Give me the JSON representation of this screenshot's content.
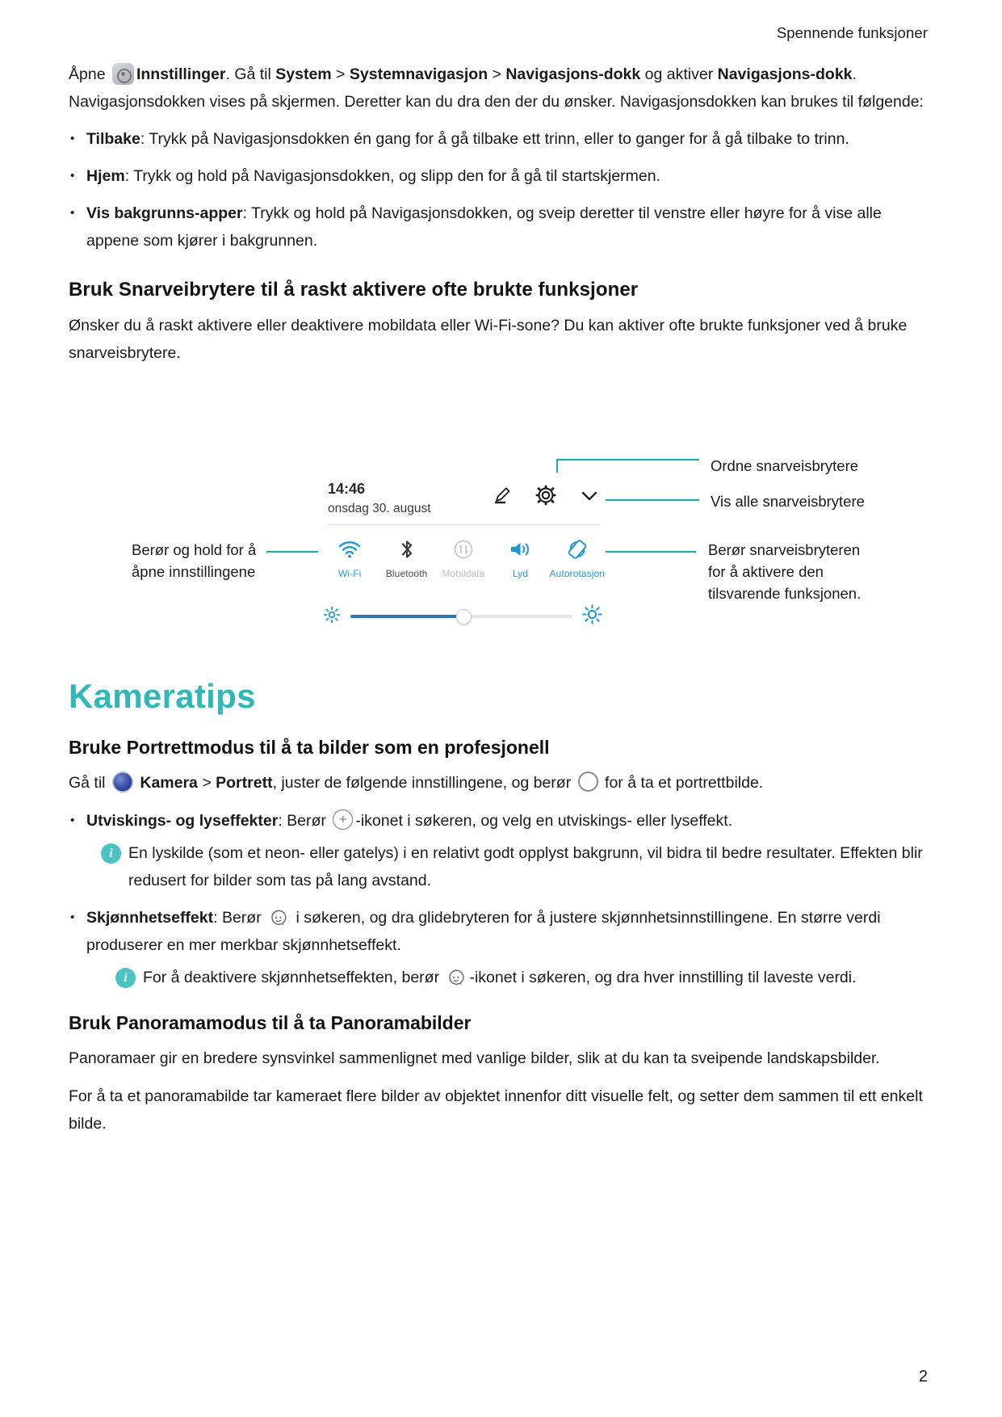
{
  "header": {
    "running_head": "Spennende funksjoner"
  },
  "page_number": "2",
  "intro": {
    "p1_a": "Åpne",
    "p1_icon": "settings-icon",
    "p1_b": "Innstillinger",
    "p1_c": ". Gå til ",
    "p1_d": "System",
    "p1_e": " > ",
    "p1_f": "Systemnavigasjon",
    "p1_g": " > ",
    "p1_h": "Navigasjons-dokk",
    "p1_i": " og aktiver ",
    "p1_j": "Navigasjons-dokk",
    "p1_k": ". Navigasjonsdokken vises på skjermen. Deretter kan du dra den der du ønsker. Navigasjonsdokken kan brukes til følgende:"
  },
  "nav_bullets": [
    {
      "term": "Tilbake",
      "text": ": Trykk på Navigasjonsdokken én gang for å gå tilbake ett trinn, eller to ganger for å gå tilbake to trinn."
    },
    {
      "term": "Hjem",
      "text": ": Trykk og hold på Navigasjonsdokken, og slipp den for å gå til startskjermen."
    },
    {
      "term": "Vis bakgrunns-apper",
      "text": ": Trykk og hold på Navigasjonsdokken, og sveip deretter til venstre eller høyre for å vise alle appene som kjører i bakgrunnen."
    }
  ],
  "shortcut_section": {
    "heading": "Bruk Snarveibrytere til å raskt aktivere ofte brukte funksjoner",
    "body": "Ønsker du å raskt aktivere eller deaktivere mobildata eller Wi-Fi-sone? Du kan aktiver ofte brukte funksjoner ved å bruke snarveisbrytere."
  },
  "figure": {
    "panel": {
      "time": "14:46",
      "date": "onsdag 30. august",
      "actions": [
        {
          "name": "edit-pencil-icon"
        },
        {
          "name": "gear-icon"
        },
        {
          "name": "chevron-down-icon"
        }
      ],
      "toggles": [
        {
          "label": "Wi-Fi",
          "icon": "wifi-icon",
          "state": "on"
        },
        {
          "label": "Bluetooth",
          "icon": "bluetooth-icon",
          "state": "off"
        },
        {
          "label": "Mobildata",
          "icon": "mobile-data-icon",
          "state": "dim"
        },
        {
          "label": "Lyd",
          "icon": "sound-icon",
          "state": "on"
        },
        {
          "label": "Autorotasjon",
          "icon": "auto-rotate-icon",
          "state": "on"
        }
      ],
      "brightness": {
        "low_icon": "brightness-low-icon",
        "high_icon": "brightness-high-icon",
        "value_percent": "51"
      }
    },
    "callouts": {
      "c1": "Ordne snarveisbrytere",
      "c2": "Vis alle snarveisbrytere",
      "c3_line1": "Berør og hold for å",
      "c3_line2": "åpne innstillingene",
      "c4_line1": "Berør snarveisbryteren",
      "c4_line2": "for å aktivere den",
      "c4_line3": "tilsvarende funksjonen."
    },
    "accent_color": "#21adad"
  },
  "chapter": {
    "title": "Kameratips",
    "color": "#2eb8b8"
  },
  "portrait_section": {
    "heading": "Bruke Portrettmodus til å ta bilder som en profesjonell",
    "intro_a": "Gå til ",
    "intro_icon": "camera-app-icon",
    "intro_b": "Kamera",
    "intro_c": " > ",
    "intro_d": "Portrett",
    "intro_e": ", juster de følgende innstillingene, og berør ",
    "intro_shutter_icon": "shutter-icon",
    "intro_f": " for å ta et portrettbilde.",
    "bullets": [
      {
        "term": "Utviskings- og lyseffekter",
        "text_a": ": Berør ",
        "icon": "aperture-plus-icon",
        "text_b": "-ikonet i søkeren, og velg en utviskings- eller lyseffekt.",
        "note": "En lyskilde (som et neon- eller gatelys) i en relativt godt opplyst bakgrunn, vil bidra til bedre resultater. Effekten blir redusert for bilder som tas på lang avstand."
      },
      {
        "term": "Skjønnhetseffekt",
        "text_a": ": Berør ",
        "icon": "beauty-face-icon",
        "text_b": " i søkeren, og dra glidebryteren for å justere skjønnhetsinnstillingene. En større verdi produserer en mer merkbar skjønnhetseffekt.",
        "note_a": "For å deaktivere skjønnhetseffekten, berør ",
        "note_icon": "beauty-face-icon",
        "note_b": "-ikonet i søkeren, og dra hver innstilling til laveste verdi."
      }
    ]
  },
  "panorama_section": {
    "heading": "Bruk Panoramamodus til å ta Panoramabilder",
    "p1": "Panoramaer gir en bredere synsvinkel sammenlignet med vanlige bilder, slik at du kan ta sveipende landskapsbilder.",
    "p2": "For å ta et panoramabilde tar kameraet flere bilder av objektet innenfor ditt visuelle felt, og setter dem sammen til ett enkelt bilde."
  }
}
